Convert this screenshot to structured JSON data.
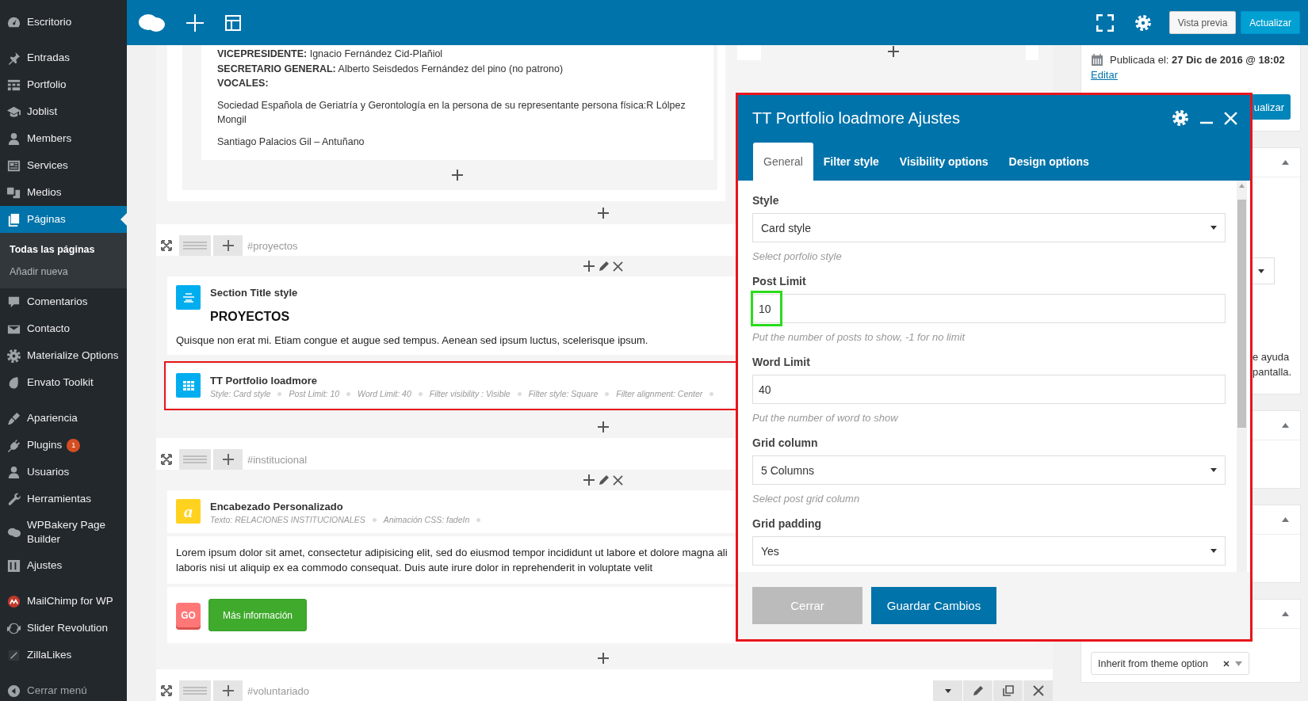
{
  "sidebar": {
    "groups": [
      [
        {
          "label": "Escritorio",
          "selected": false
        }
      ],
      [
        {
          "label": "Entradas",
          "selected": false
        },
        {
          "label": "Portfolio",
          "selected": false
        },
        {
          "label": "Joblist",
          "selected": false
        },
        {
          "label": "Members",
          "selected": false
        },
        {
          "label": "Services",
          "selected": false
        },
        {
          "label": "Medios",
          "selected": false
        },
        {
          "label": "Páginas",
          "selected": true,
          "children": [
            {
              "label": "Todas las páginas",
              "selected": true
            },
            {
              "label": "Añadir nueva",
              "selected": false
            }
          ]
        },
        {
          "label": "Comentarios",
          "selected": false
        },
        {
          "label": "Contacto",
          "selected": false
        },
        {
          "label": "Materialize Options",
          "selected": false
        },
        {
          "label": "Envato Toolkit",
          "selected": false
        }
      ],
      [
        {
          "label": "Apariencia",
          "selected": false
        },
        {
          "label": "Plugins",
          "selected": false,
          "badge": "1"
        },
        {
          "label": "Usuarios",
          "selected": false
        },
        {
          "label": "Herramientas",
          "selected": false
        },
        {
          "label": "WPBakery Page Builder",
          "selected": false
        },
        {
          "label": "Ajustes",
          "selected": false
        }
      ],
      [
        {
          "label": "MailChimp for WP",
          "selected": false
        },
        {
          "label": "Slider Revolution",
          "selected": false
        },
        {
          "label": "ZillaLikes",
          "selected": false
        }
      ]
    ],
    "collapse": "Cerrar menú"
  },
  "toolbar": {
    "buttons": [
      {
        "label": "Vista previa",
        "kind": "secondary"
      },
      {
        "label": "Actualizar",
        "kind": "primary"
      }
    ]
  },
  "editor": {
    "top_row": {
      "lines": [
        "**VICEPRESIDENTE:** Ignacio Fernández Cid-Plañiol",
        "**SECRETARIO GENERAL:** Alberto Seisdedos Fernández del pino (no patrono)",
        "**VOCALES:**"
      ],
      "paragraphs": [
        "Sociedad Española de Geriatría y Gerontología en la persona de su representante persona física:R Lólpez Mongil",
        "Santiago Palacios Gil – Antuñano"
      ]
    },
    "rows": [
      {
        "anchor": "#proyectos",
        "elements": [
          {
            "kind": "section_title",
            "title": "Section Title style",
            "heading": "PROYECTOS",
            "text": "Quisque non erat mi. Etiam congue et augue sed tempus. Aenean sed ipsum luctus, scelerisque ipsum."
          },
          {
            "kind": "portfolio",
            "title": "TT Portfolio loadmore",
            "highlighted": true,
            "meta": [
              "Style: Card style",
              "Post Limit: 10",
              "Word Limit: 40",
              "Filter visibility : Visible",
              "Filter style: Square",
              "Filter alignment: Center"
            ]
          }
        ]
      },
      {
        "anchor": "#institucional",
        "elements": [
          {
            "kind": "heading",
            "icon_label": "a",
            "title": "Encabezado Personalizado",
            "meta": [
              "Texto: RELACIONES INSTITUCIONALES",
              "Animación CSS: fadeIn"
            ]
          },
          {
            "kind": "text",
            "lines": [
              "Lorem ipsum dolor sit amet, consectetur adipisicing elit, sed do eiusmod tempor incididunt ut labore et dolore magna ali",
              "laboris nisi ut aliquip ex ea commodo consequat. Duis aute irure dolor in reprehenderit in voluptate velit"
            ]
          },
          {
            "kind": "buttons",
            "badge": "GO",
            "button": "Más información"
          }
        ]
      },
      {
        "anchor": "#voluntariado",
        "tools": true,
        "elements": []
      }
    ]
  },
  "side_panel": {
    "publish": {
      "text": "Publicada el: **27 Dic de 2016 @ 18:02**",
      "link": "Editar",
      "button": "ualizar"
    },
    "boxes": [
      {
        "kind": "help",
        "fragments": [
          "e ayuda",
          "pantalla."
        ]
      },
      {
        "kind": "empty"
      },
      {
        "kind": "empty"
      },
      {
        "kind": "select",
        "value": "Inherit from theme option"
      }
    ]
  },
  "modal": {
    "title": "TT Portfolio loadmore Ajustes",
    "highlighted": true,
    "tabs": [
      {
        "label": "General",
        "selected": true
      },
      {
        "label": "Filter style",
        "selected": false
      },
      {
        "label": "Visibility options",
        "selected": false
      },
      {
        "label": "Design options",
        "selected": false
      }
    ],
    "fields": [
      {
        "kind": "select",
        "label": "Style",
        "value": "Card style",
        "help": "Select porfolio style"
      },
      {
        "kind": "input",
        "label": "Post Limit",
        "value": "10",
        "help": "Put the number of posts to show, -1 for no limit",
        "highlighted": true
      },
      {
        "kind": "input",
        "label": "Word Limit",
        "value": "40",
        "help": "Put the number of word to show"
      },
      {
        "kind": "select",
        "label": "Grid column",
        "value": "5 Columns",
        "help": "Select post grid column"
      },
      {
        "kind": "select",
        "label": "Grid padding",
        "value": "Yes"
      }
    ],
    "buttons": [
      {
        "label": "Cerrar",
        "kind": "secondary"
      },
      {
        "label": "Guardar Cambios",
        "kind": "primary"
      }
    ]
  }
}
